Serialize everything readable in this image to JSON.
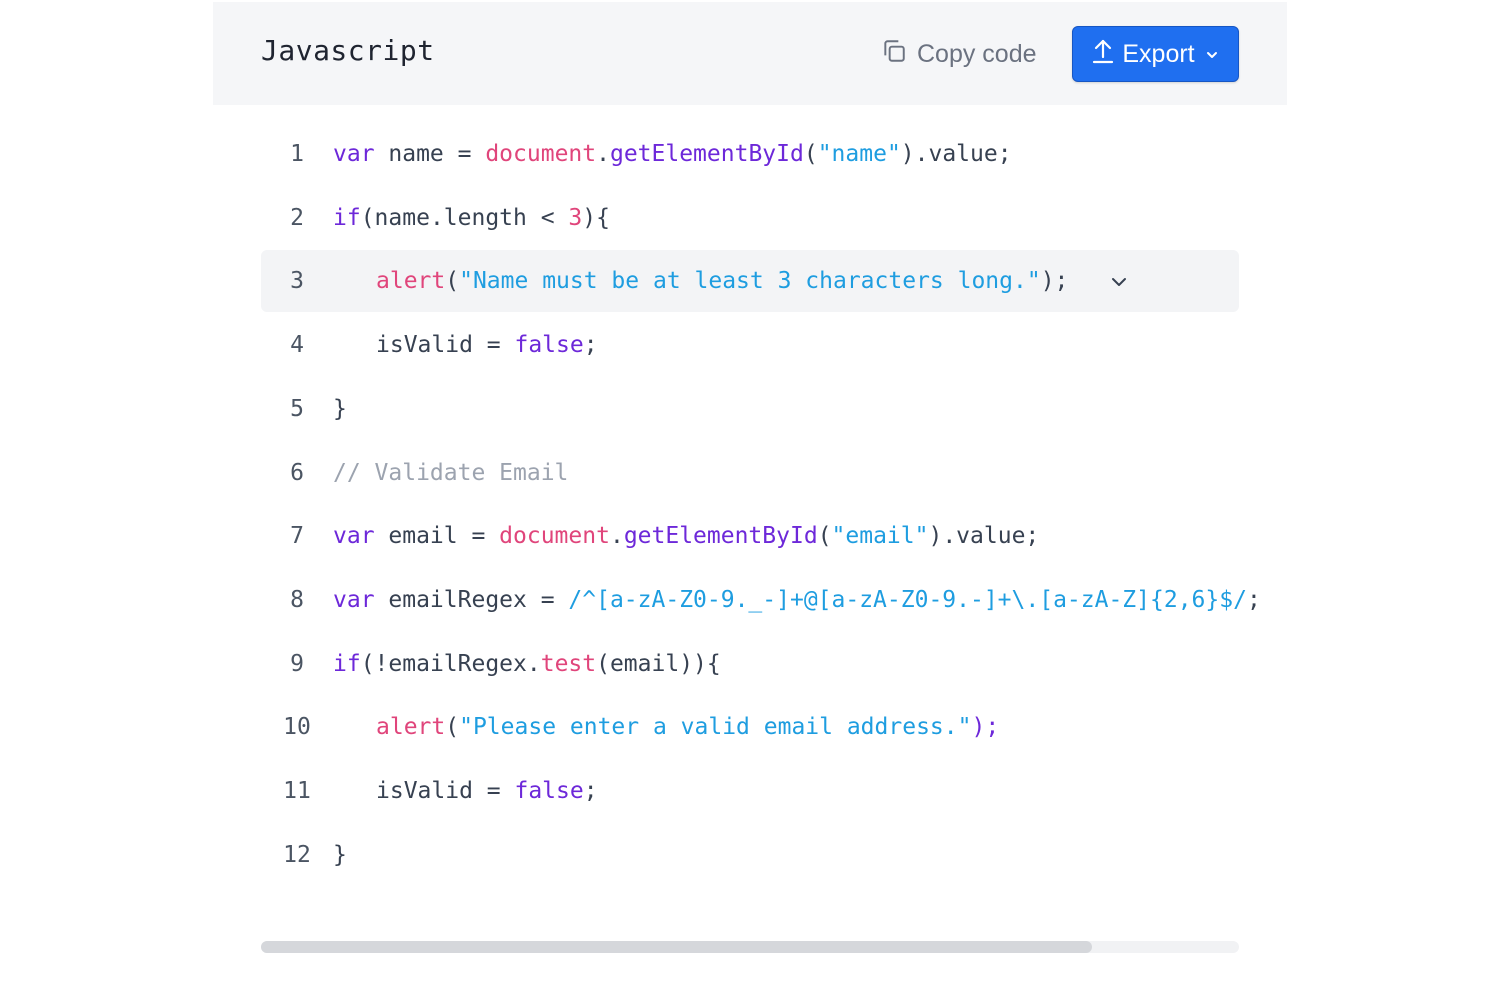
{
  "header": {
    "language": "Javascript",
    "copy_label": "Copy code",
    "export_label": "Export"
  },
  "code": {
    "lines": [
      {
        "n": "1",
        "indent": 0,
        "tokens": [
          [
            "kw",
            "var"
          ],
          [
            "plain",
            " name = "
          ],
          [
            "obj",
            "document"
          ],
          [
            "plain",
            "."
          ],
          [
            "fn",
            "getElementById"
          ],
          [
            "plain",
            "("
          ],
          [
            "str",
            "\"name\""
          ],
          [
            "plain",
            ").value;"
          ]
        ]
      },
      {
        "n": "2",
        "indent": 0,
        "tokens": [
          [
            "kw",
            "if"
          ],
          [
            "plain",
            "(name.length < "
          ],
          [
            "num",
            "3"
          ],
          [
            "plain",
            "){"
          ]
        ]
      },
      {
        "n": "3",
        "indent": 1,
        "highlight": true,
        "fold": true,
        "tokens": [
          [
            "obj",
            "alert"
          ],
          [
            "plain",
            "("
          ],
          [
            "str",
            "\"Name must be at least 3 characters long.\""
          ],
          [
            "plain",
            ");"
          ]
        ]
      },
      {
        "n": "4",
        "indent": 1,
        "tokens": [
          [
            "plain",
            "isValid = "
          ],
          [
            "kw",
            "false"
          ],
          [
            "plain",
            ";"
          ]
        ]
      },
      {
        "n": "5",
        "indent": 0,
        "tokens": [
          [
            "plain",
            "}"
          ]
        ]
      },
      {
        "n": "6",
        "indent": 0,
        "tokens": [
          [
            "cmt",
            "// Validate Email"
          ]
        ]
      },
      {
        "n": "7",
        "indent": 0,
        "tokens": [
          [
            "kw",
            "var"
          ],
          [
            "plain",
            " email = "
          ],
          [
            "obj",
            "document"
          ],
          [
            "plain",
            "."
          ],
          [
            "fn",
            "getElementById"
          ],
          [
            "plain",
            "("
          ],
          [
            "str",
            "\"email\""
          ],
          [
            "plain",
            ").value;"
          ]
        ]
      },
      {
        "n": "8",
        "indent": 0,
        "tokens": [
          [
            "kw",
            "var"
          ],
          [
            "plain",
            " emailRegex = "
          ],
          [
            "re",
            "/^[a-zA-Z0-9._-]+@[a-zA-Z0-9.-]+\\.[a-zA-Z]{2,6}$/"
          ],
          [
            "plain",
            ";"
          ]
        ]
      },
      {
        "n": "9",
        "indent": 0,
        "tokens": [
          [
            "kw",
            "if"
          ],
          [
            "plain",
            "(!emailRegex."
          ],
          [
            "obj",
            "test"
          ],
          [
            "plain",
            "(email)){"
          ]
        ]
      },
      {
        "n": "10",
        "indent": 1,
        "tokens": [
          [
            "obj",
            "alert"
          ],
          [
            "plain",
            "("
          ],
          [
            "str",
            "\"Please enter a valid email address.\""
          ],
          [
            "kw",
            ");"
          ]
        ]
      },
      {
        "n": "11",
        "indent": 1,
        "tokens": [
          [
            "plain",
            "isValid = "
          ],
          [
            "kw",
            "false"
          ],
          [
            "plain",
            ";"
          ]
        ]
      },
      {
        "n": "12",
        "indent": 0,
        "tokens": [
          [
            "plain",
            "}"
          ]
        ]
      }
    ]
  },
  "scrollbar": {
    "position_fraction": 0.0,
    "visible_fraction": 0.85
  },
  "colors": {
    "accent": "#1f6ff0",
    "keyword": "#6d28d9",
    "string": "#1e9de0",
    "builtin": "#e0457b",
    "comment": "#9ca3af"
  },
  "icons": {
    "copy": "copy-icon",
    "export": "upload-icon",
    "dropdown": "chevron-down-icon",
    "fold": "chevron-down-icon"
  }
}
